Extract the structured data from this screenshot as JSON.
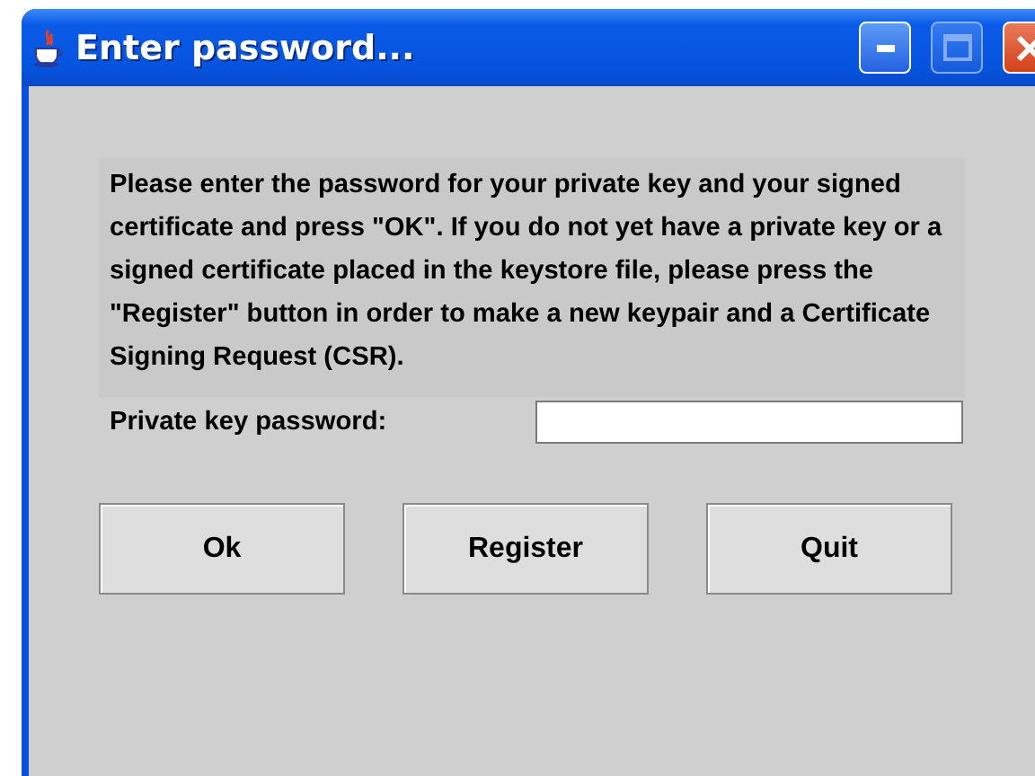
{
  "window": {
    "title": "Enter password...",
    "controls": [
      {
        "kind": "minimize",
        "disabled": false
      },
      {
        "kind": "maximize",
        "disabled": true
      },
      {
        "kind": "close",
        "disabled": false
      }
    ]
  },
  "message": "Please enter the password for your private key and your signed certificate and press \"OK\". If you do not yet have a private key or a signed certificate placed in the keystore file, please press the \"Register\" button in order to make a new keypair and a Certificate Signing Request (CSR).",
  "password_field": {
    "label": "Private key password:"
  },
  "buttons": [
    "Ok",
    "Register",
    "Quit"
  ]
}
